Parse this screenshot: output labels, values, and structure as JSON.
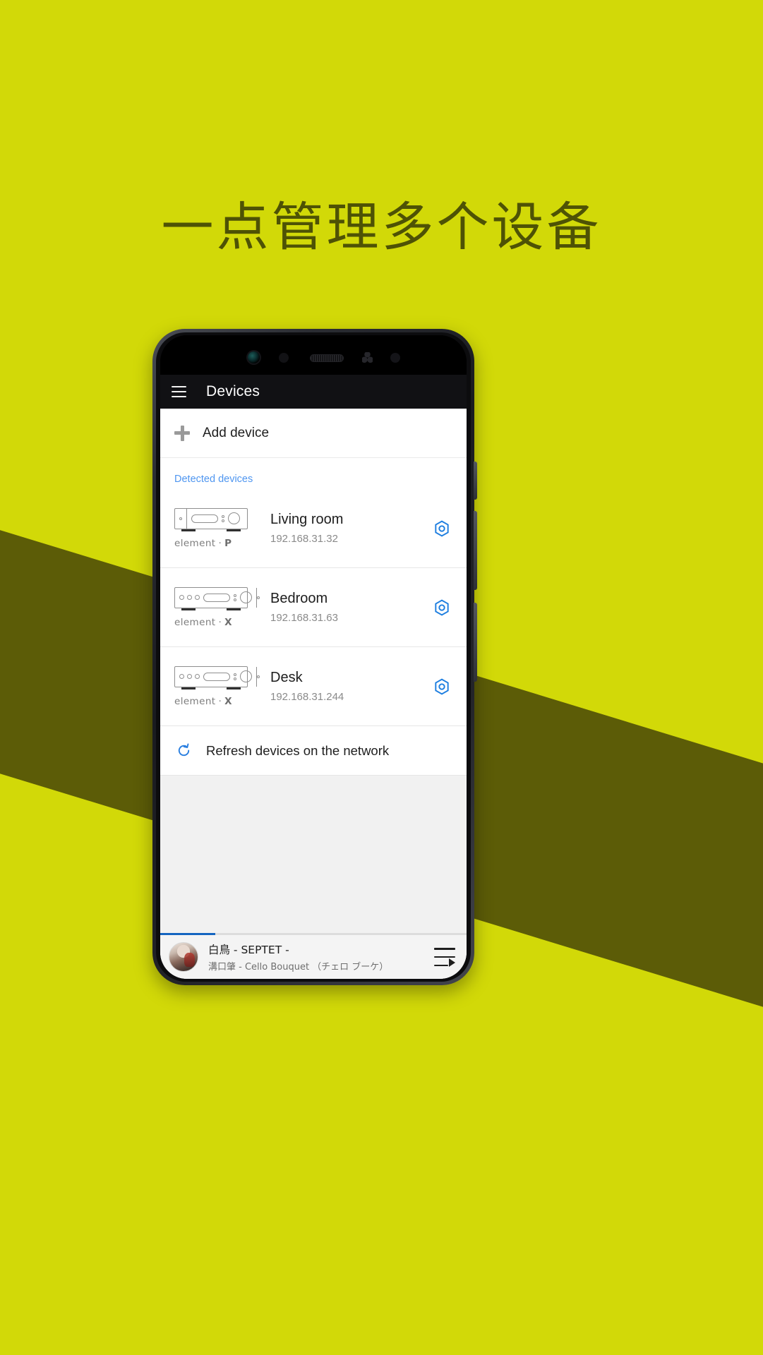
{
  "promo": {
    "headline": "一点管理多个设备",
    "background_color": "#d2d908",
    "band_color": "#5c5c07",
    "headline_color": "#4e5205"
  },
  "appbar": {
    "menu_icon": "hamburger-menu-icon",
    "title": "Devices"
  },
  "add_device": {
    "icon": "plus-icon",
    "label": "Add device"
  },
  "section": {
    "detected_label": "Detected devices",
    "detected_label_color": "#4f96f0"
  },
  "devices": [
    {
      "name": "Living room",
      "ip": "192.168.31.32",
      "brand": "element",
      "brand_mark": "P",
      "icon": "amplifier-single-icon",
      "settings_icon": "gear-icon",
      "settings_color": "#1f7fe0"
    },
    {
      "name": "Bedroom",
      "ip": "192.168.31.63",
      "brand": "element",
      "brand_mark": "X",
      "icon": "amplifier-triple-icon",
      "settings_icon": "gear-icon",
      "settings_color": "#1f7fe0"
    },
    {
      "name": "Desk",
      "ip": "192.168.31.244",
      "brand": "element",
      "brand_mark": "X",
      "icon": "amplifier-triple-icon",
      "settings_icon": "gear-icon",
      "settings_color": "#1f7fe0"
    }
  ],
  "refresh": {
    "icon": "refresh-icon",
    "icon_color": "#2a7fe0",
    "label": "Refresh devices on the network"
  },
  "now_playing": {
    "title": "白鳥 - SEPTET -",
    "subtitle": "溝口肇 - Cello Bouquet （チェロ ブーケ）",
    "queue_icon": "queue-play-icon",
    "progress_percent": 18,
    "progress_color": "#1565c0"
  }
}
